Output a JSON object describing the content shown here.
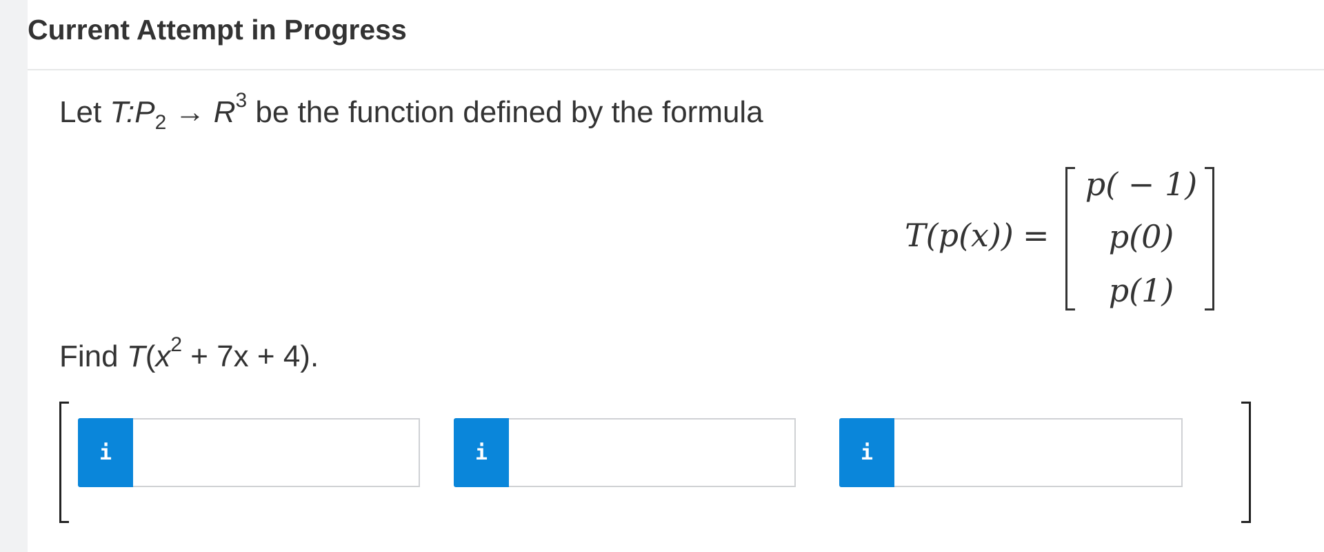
{
  "header": {
    "title": "Current Attempt in Progress"
  },
  "question": {
    "intro": {
      "lead": "Let ",
      "map_domain": "T:P",
      "domain_subscript": "2",
      "arrow": " → ",
      "codomain": "R",
      "codomain_superscript": "3",
      "trailing": " be the function defined by the formula"
    },
    "formula": {
      "lhs": "T(p(x))",
      "equals": "=",
      "matrix_entries": [
        "p( − 1)",
        "p(0)",
        "p(1)"
      ]
    },
    "find": {
      "lead": "Find ",
      "func": "T",
      "open": "(",
      "var": "x",
      "exponent": "2",
      "rest": " + 7x + 4)."
    }
  },
  "answer": {
    "fields": [
      {
        "info_icon": "i",
        "value": ""
      },
      {
        "info_icon": "i",
        "value": ""
      },
      {
        "info_icon": "i",
        "value": ""
      }
    ]
  },
  "colors": {
    "info_button": "#0a86da",
    "input_border": "#cfd1d4",
    "text": "#333333",
    "gutter": "#f1f2f3"
  }
}
